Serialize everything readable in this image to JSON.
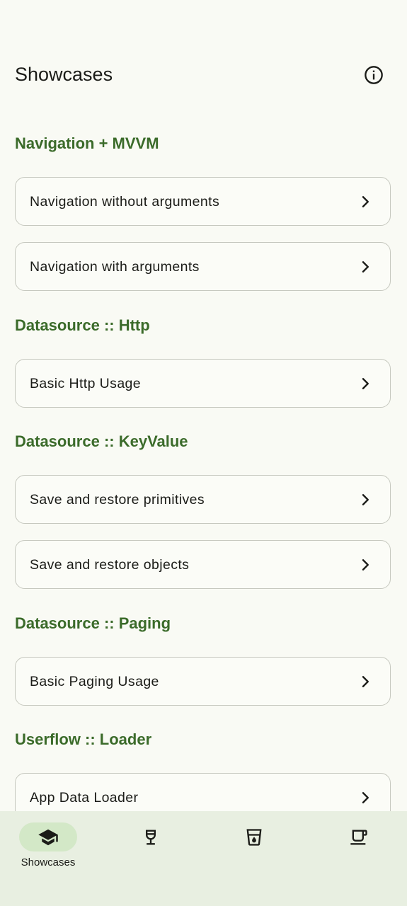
{
  "app": {
    "title": "Showcases",
    "info_icon": "info-icon"
  },
  "sections": [
    {
      "title": "Navigation + MVVM",
      "items": [
        {
          "label": "Navigation without arguments"
        },
        {
          "label": "Navigation with arguments"
        }
      ]
    },
    {
      "title": "Datasource :: Http",
      "items": [
        {
          "label": "Basic Http Usage"
        }
      ]
    },
    {
      "title": "Datasource :: KeyValue",
      "items": [
        {
          "label": "Save and restore primitives"
        },
        {
          "label": "Save and restore objects"
        }
      ]
    },
    {
      "title": "Datasource :: Paging",
      "items": [
        {
          "label": "Basic Paging Usage"
        }
      ]
    },
    {
      "title": "Userflow :: Loader",
      "items": [
        {
          "label": "App Data Loader"
        }
      ]
    }
  ],
  "bottom_nav": {
    "items": [
      {
        "label": "Showcases",
        "icon": "graduation-cap-icon",
        "selected": true
      },
      {
        "label": "",
        "icon": "wine-glass-icon",
        "selected": false
      },
      {
        "label": "",
        "icon": "water-glass-icon",
        "selected": false
      },
      {
        "label": "",
        "icon": "coffee-cup-icon",
        "selected": false
      }
    ]
  },
  "colors": {
    "background": "#f9faf4",
    "section_title": "#3b6b2a",
    "card_border": "#c6c8bf",
    "nav_background": "#e8efe1",
    "nav_selected_pill": "#d3e8c7"
  }
}
